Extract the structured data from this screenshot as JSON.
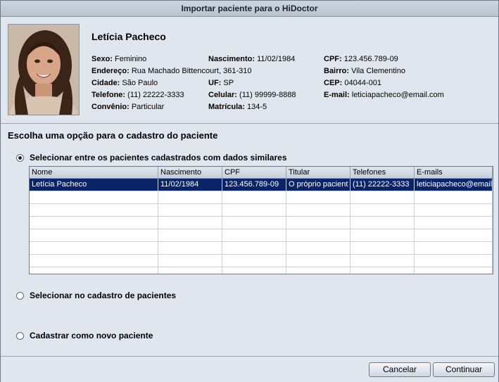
{
  "window": {
    "title": "Importar paciente para o HiDoctor"
  },
  "patient": {
    "name": "Letícia Pacheco",
    "fields": {
      "sexo": {
        "label": "Sexo:",
        "value": "Feminino"
      },
      "nascimento": {
        "label": "Nascimento:",
        "value": "11/02/1984"
      },
      "cpf": {
        "label": "CPF:",
        "value": "123.456.789-09"
      },
      "endereco": {
        "label": "Endereço:",
        "value": "Rua Machado Bittencourt, 361-310"
      },
      "bairro": {
        "label": "Bairro:",
        "value": "Vila Clementino"
      },
      "cidade": {
        "label": "Cidade:",
        "value": "São Paulo"
      },
      "uf": {
        "label": "UF:",
        "value": "SP"
      },
      "cep": {
        "label": "CEP:",
        "value": "04044-001"
      },
      "telefone": {
        "label": "Telefone:",
        "value": "(11) 22222-3333"
      },
      "celular": {
        "label": "Celular:",
        "value": "(11) 99999-8888"
      },
      "email": {
        "label": "E-mail:",
        "value": "leticiapacheco@email.com"
      },
      "convenio": {
        "label": "Convênio:",
        "value": "Particular"
      },
      "matricula": {
        "label": "Matrícula:",
        "value": "134-5"
      }
    }
  },
  "options": {
    "title": "Escolha uma opção para o cadastro do paciente",
    "similar": "Selecionar entre os pacientes cadastrados com dados similares",
    "registry": "Selecionar no cadastro de pacientes",
    "new": "Cadastrar como novo paciente",
    "selected": "similar"
  },
  "table": {
    "columns": [
      "Nome",
      "Nascimento",
      "CPF",
      "Titular",
      "Telefones",
      "E-mails"
    ],
    "rows": [
      [
        "Letícia Pacheco",
        "11/02/1984",
        "123.456.789-09",
        "O próprio pacient",
        "(11) 22222-3333",
        "leticiapacheco@email"
      ]
    ]
  },
  "buttons": {
    "cancel": "Cancelar",
    "continue": "Continuar"
  }
}
